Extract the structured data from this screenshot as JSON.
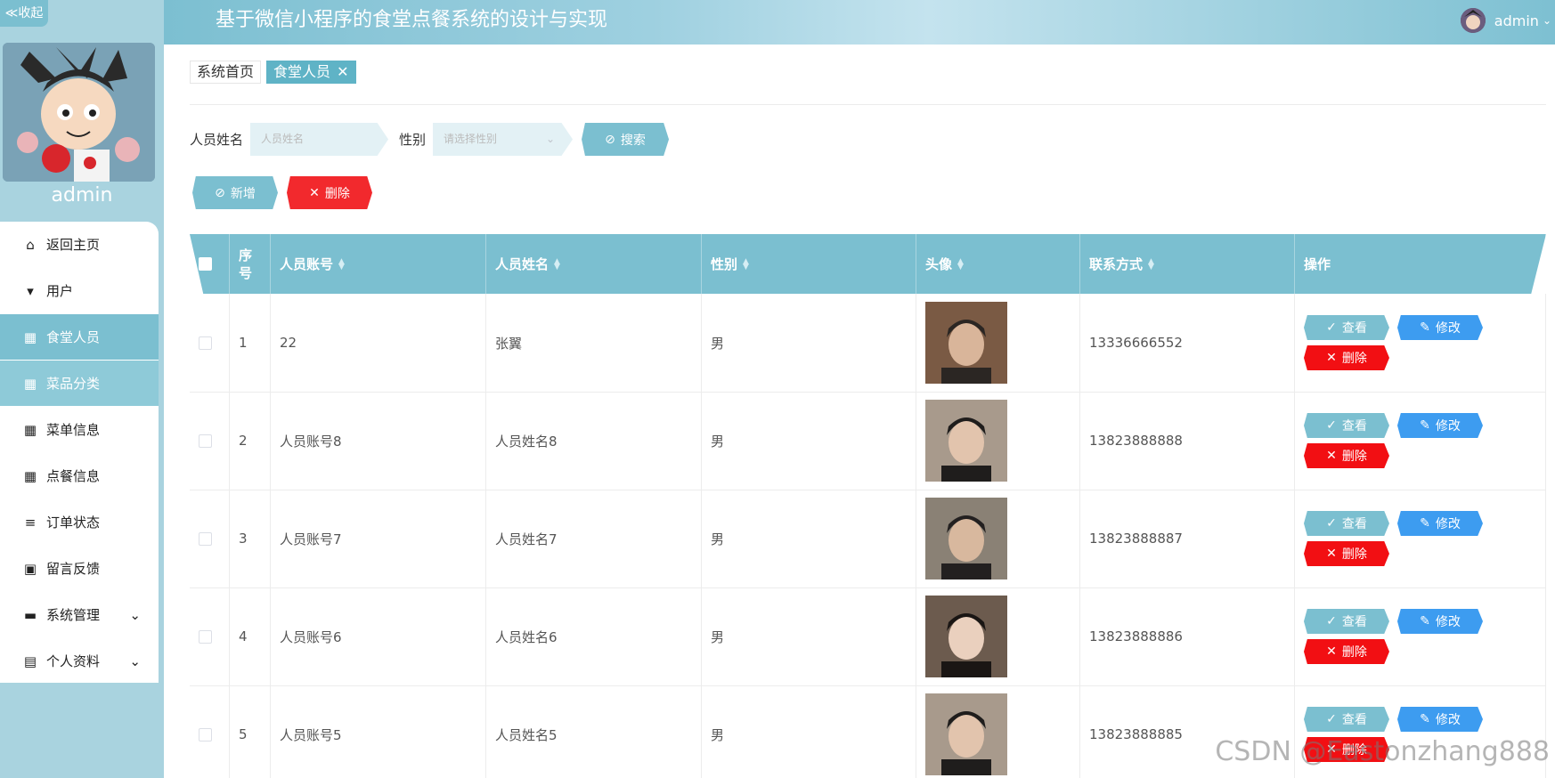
{
  "collapse": {
    "label": "≪收起"
  },
  "sidebar": {
    "username": "admin",
    "items": [
      {
        "label": "返回主页",
        "icon": "home-icon",
        "state": "normal"
      },
      {
        "label": "用户",
        "icon": "pin-icon",
        "state": "normal"
      },
      {
        "label": "食堂人员",
        "icon": "grid-icon",
        "state": "active"
      },
      {
        "label": "菜品分类",
        "icon": "grid-icon",
        "state": "hover"
      },
      {
        "label": "菜单信息",
        "icon": "grid-icon",
        "state": "normal"
      },
      {
        "label": "点餐信息",
        "icon": "grid-icon",
        "state": "normal"
      },
      {
        "label": "订单状态",
        "icon": "list-icon",
        "state": "normal"
      },
      {
        "label": "留言反馈",
        "icon": "clipboard-icon",
        "state": "normal"
      },
      {
        "label": "系统管理",
        "icon": "briefcase-icon",
        "state": "normal",
        "expandable": true
      },
      {
        "label": "个人资料",
        "icon": "card-icon",
        "state": "normal",
        "expandable": true
      }
    ]
  },
  "header": {
    "title": "基于微信小程序的食堂点餐系统的设计与实现",
    "user": "admin"
  },
  "breadcrumb": {
    "home": "系统首页",
    "current": "食堂人员",
    "close": "✕"
  },
  "search": {
    "name_label": "人员姓名",
    "name_placeholder": "人员姓名",
    "gender_label": "性别",
    "gender_placeholder": "请选择性别",
    "button": "搜索"
  },
  "actions": {
    "add": "新增",
    "delete": "删除"
  },
  "table": {
    "columns": [
      "序号",
      "人员账号",
      "人员姓名",
      "性别",
      "头像",
      "联系方式",
      "操作"
    ],
    "rows": [
      {
        "index": "1",
        "account": "22",
        "name": "张翼",
        "gender": "男",
        "phone": "13336666552"
      },
      {
        "index": "2",
        "account": "人员账号8",
        "name": "人员姓名8",
        "gender": "男",
        "phone": "13823888888"
      },
      {
        "index": "3",
        "account": "人员账号7",
        "name": "人员姓名7",
        "gender": "男",
        "phone": "13823888887"
      },
      {
        "index": "4",
        "account": "人员账号6",
        "name": "人员姓名6",
        "gender": "男",
        "phone": "13823888886"
      },
      {
        "index": "5",
        "account": "人员账号5",
        "name": "人员姓名5",
        "gender": "男",
        "phone": "13823888885"
      }
    ],
    "op_labels": {
      "view": "查看",
      "edit": "修改",
      "delete": "删除"
    }
  },
  "watermark": "CSDN @Eastonzhang888",
  "colors": {
    "accent": "#7bbfd0",
    "danger": "#f20f13",
    "edit": "#3d9cf0",
    "sidebar_bg": "#a9d3df"
  }
}
